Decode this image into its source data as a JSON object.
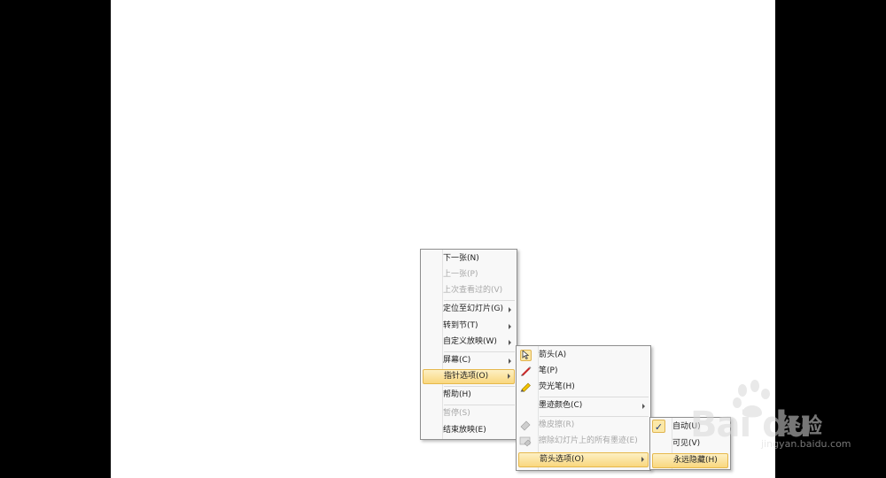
{
  "main_menu": {
    "items": [
      {
        "label": "下一张(N)",
        "disabled": false
      },
      {
        "label": "上一张(P)",
        "disabled": true
      },
      {
        "label": "上次查看过的(V)",
        "disabled": true
      },
      {
        "label": "定位至幻灯片(G)",
        "disabled": false,
        "submenu": true
      },
      {
        "label": "转到节(T)",
        "disabled": false,
        "submenu": true
      },
      {
        "label": "自定义放映(W)",
        "disabled": false,
        "submenu": true
      },
      {
        "label": "屏幕(C)",
        "disabled": false,
        "submenu": true
      },
      {
        "label": "指针选项(O)",
        "disabled": false,
        "submenu": true,
        "highlighted": true
      },
      {
        "label": "帮助(H)",
        "disabled": false
      },
      {
        "label": "暂停(S)",
        "disabled": true
      },
      {
        "label": "结束放映(E)",
        "disabled": false
      }
    ]
  },
  "pointer_menu": {
    "items": [
      {
        "label": "箭头(A)",
        "icon": "pointer-arrow-icon",
        "checked": true
      },
      {
        "label": "笔(P)",
        "icon": "pen-icon"
      },
      {
        "label": "荧光笔(H)",
        "icon": "highlighter-icon"
      },
      {
        "label": "墨迹颜色(C)",
        "submenu": true
      },
      {
        "label": "橡皮擦(R)",
        "icon": "eraser-icon",
        "disabled": true
      },
      {
        "label": "擦除幻灯片上的所有墨迹(E)",
        "icon": "erase-all-icon",
        "disabled": true
      },
      {
        "label": "箭头选项(O)",
        "submenu": true,
        "highlighted": true
      }
    ]
  },
  "arrow_options_menu": {
    "items": [
      {
        "label": "自动(U)",
        "checked": true
      },
      {
        "label": "可见(V)"
      },
      {
        "label": "永远隐藏(H)",
        "highlighted": true
      }
    ],
    "check_glyph": "✓"
  },
  "watermark": {
    "brand": "Bai du",
    "brand_cn": "经验",
    "url": "jingyan.baidu.com"
  },
  "colors": {
    "highlight_top": "#fdf0c4",
    "highlight_bottom": "#f9d77e",
    "highlight_border": "#e6b84c"
  }
}
